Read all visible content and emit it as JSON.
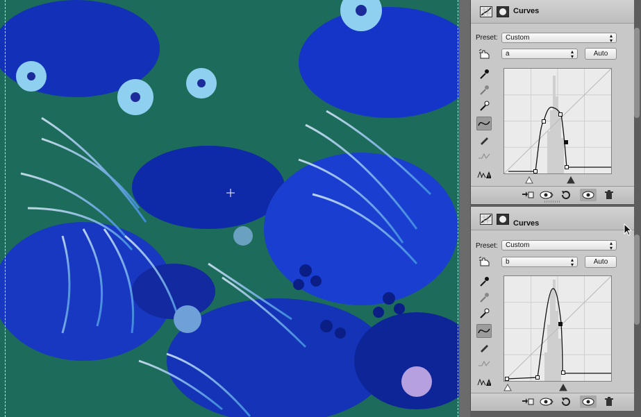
{
  "colors": {
    "canvas_background": "#1d6b5a",
    "leaf_blue": "#1f3fc7",
    "accent": "#2b7fff"
  },
  "panels": [
    {
      "id": "a-channel",
      "title": "Curves",
      "preset_label": "Preset:",
      "preset_value": "Custom",
      "channel_value": "a",
      "auto_label": "Auto",
      "tools": [
        "eyedropper-black-point-icon",
        "eyedropper-gray-point-icon",
        "eyedropper-white-point-icon",
        "curve-points-icon",
        "pencil-icon",
        "smooth-icon",
        "clipping-warning-icon"
      ],
      "footer_icons": [
        "clip-to-layer-icon",
        "eye-previous-state-icon",
        "reset-icon",
        "visibility-eye-icon",
        "trash-icon"
      ]
    },
    {
      "id": "b-channel",
      "title": "Curves",
      "preset_label": "Preset:",
      "preset_value": "Custom",
      "channel_value": "b",
      "auto_label": "Auto",
      "tools": [
        "eyedropper-black-point-icon",
        "eyedropper-gray-point-icon",
        "eyedropper-white-point-icon",
        "curve-points-icon",
        "pencil-icon",
        "smooth-icon",
        "clipping-warning-icon"
      ],
      "footer_icons": [
        "clip-to-layer-icon",
        "eye-previous-state-icon",
        "reset-icon",
        "visibility-eye-icon",
        "trash-icon"
      ]
    }
  ]
}
